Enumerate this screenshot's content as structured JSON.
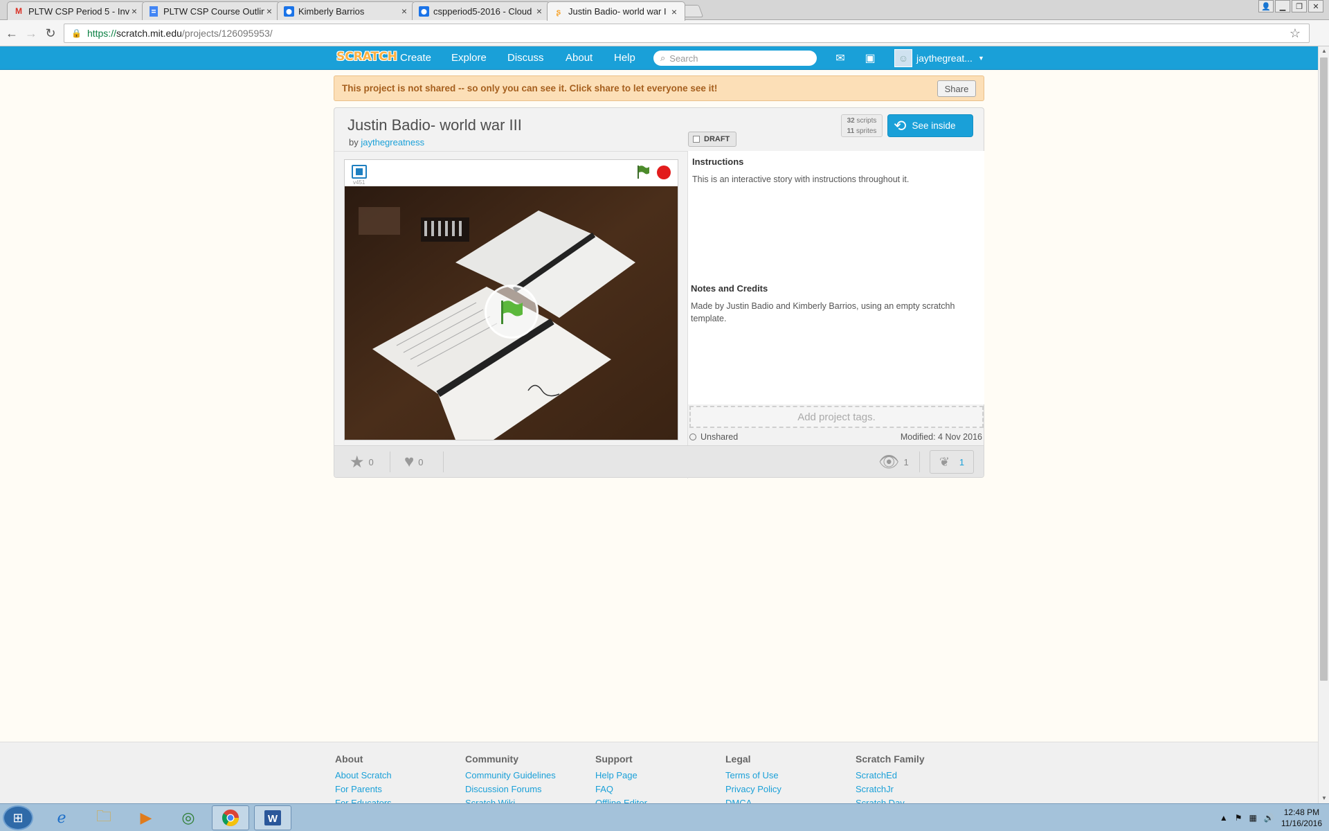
{
  "browser": {
    "tabs": [
      {
        "label": "PLTW CSP Period 5 - Inv",
        "icon": "gmail-icon",
        "active": false
      },
      {
        "label": "PLTW CSP Course Outlin",
        "icon": "docs-icon",
        "active": false
      },
      {
        "label": "Kimberly Barrios",
        "icon": "cloud-icon",
        "active": false
      },
      {
        "label": "cspperiod5-2016 - Cloud",
        "icon": "cloud-icon",
        "active": false
      },
      {
        "label": "Justin Badio- world war I",
        "icon": "scratch-icon",
        "active": true
      }
    ],
    "url": {
      "scheme": "https://",
      "host": "scratch.mit.edu",
      "path": "/projects/126095953/"
    }
  },
  "nav": {
    "logo": "SCRATCH",
    "links": [
      "Create",
      "Explore",
      "Discuss",
      "About",
      "Help"
    ],
    "search_placeholder": "Search",
    "username": "jaythegreat..."
  },
  "alert": {
    "message": "This project is not shared -- so only you can see it. Click share to let everyone see it!",
    "share_label": "Share"
  },
  "project": {
    "title": "Justin Badio- world war III",
    "by_prefix": "by",
    "author": "jaythegreatness",
    "draft_label": "DRAFT",
    "scripts_count": "32",
    "scripts_label": "scripts",
    "sprites_count": "11",
    "sprites_label": "sprites",
    "see_inside_label": "See inside",
    "player_version": "v451",
    "instructions_heading": "Instructions",
    "instructions_text": "This is an interactive story with instructions throughout it.",
    "notes_heading": "Notes and Credits",
    "notes_text": "Made by Justin Badio and Kimberly Barrios, using an empty scratchh template.",
    "tags_placeholder": "Add project tags.",
    "share_status": "Unshared",
    "modified": "Modified: 4 Nov 2016",
    "favorites": "0",
    "loves": "0",
    "views": "1",
    "remixes": "1"
  },
  "footer": {
    "columns": [
      {
        "heading": "About",
        "links": [
          "About Scratch",
          "For Parents",
          "For Educators"
        ]
      },
      {
        "heading": "Community",
        "links": [
          "Community Guidelines",
          "Discussion Forums",
          "Scratch Wiki"
        ]
      },
      {
        "heading": "Support",
        "links": [
          "Help Page",
          "FAQ",
          "Offline Editor"
        ]
      },
      {
        "heading": "Legal",
        "links": [
          "Terms of Use",
          "Privacy Policy",
          "DMCA"
        ]
      },
      {
        "heading": "Scratch Family",
        "links": [
          "ScratchEd",
          "ScratchJr",
          "Scratch Day"
        ]
      }
    ]
  },
  "taskbar": {
    "time": "12:48 PM",
    "date": "11/16/2016"
  },
  "colors": {
    "scratch_blue": "#1aa0d8",
    "alert_bg": "#fcdfb7",
    "alert_text": "#a55f1e",
    "stop_red": "#e21c1c",
    "flag_green": "#4caf50"
  }
}
